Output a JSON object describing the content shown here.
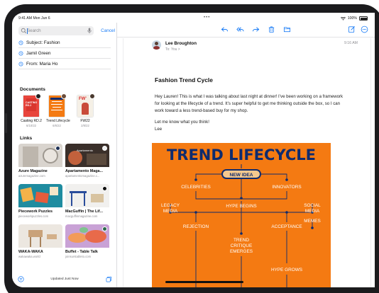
{
  "status_bar": {
    "time_date": "9:41 AM  Mon Jun 6",
    "battery": "100%"
  },
  "sidebar": {
    "search": {
      "placeholder": "Search",
      "cancel_label": "Cancel"
    },
    "suggestions": [
      {
        "label": "Subject: Fashion"
      },
      {
        "label": "Jamil Green"
      },
      {
        "label": "From: Maria Ho"
      }
    ],
    "documents_title": "Documents",
    "documents": [
      {
        "name": "Casting RD.2",
        "date": "6/10/22",
        "thumb_text": "CASTING RD.2",
        "color": "#e8453c"
      },
      {
        "name": "Trend Lifecycle",
        "date": "6/6/22",
        "thumb_text": "TREND",
        "color": "#f47a12"
      },
      {
        "name": "FW22",
        "date": "2/8/22",
        "thumb_text": "FW'22",
        "color": "#f5f0e6"
      }
    ],
    "links_title": "Links",
    "links": [
      {
        "title": "Azure Magazine",
        "url": "azuremagazine.com"
      },
      {
        "title": "Apartamento Maga...",
        "url": "apartamentomagazine.c...",
        "overlay_text": "Apartamento"
      },
      {
        "title": "Piecework Puzzles",
        "url": "pieceworkpuzzles.com"
      },
      {
        "title": "MacGuffin | The Lif...",
        "url": "macguffinmagazine.com"
      },
      {
        "title": "WAKA-WAKA",
        "url": "wakawaka.world"
      },
      {
        "title": "Buffet - Table Talk",
        "url": "joinsurstableto.com"
      }
    ],
    "updated_label": "Updated Just Now"
  },
  "message": {
    "sender": "Lee Broughton",
    "to_line": "To: You >",
    "time": "9:16 AM",
    "subject": "Fashion Trend Cycle",
    "paragraphs": [
      "Hey Lauren! This is what I was talking about last night at dinner! I’ve been working on a framework for looking at the lifecycle of a trend. It’s super helpful to get me thinking outside the box, so I can work toward a less trend-based buy for my shop.",
      "Let me know what you think!\nLee"
    ]
  },
  "infographic": {
    "title": "TREND LIFECYCLE",
    "new_idea": "NEW IDEA",
    "celebrities": "CELEBRITIES",
    "influencers": "INNOVATORS",
    "legacy_media_1": "LEGACY",
    "legacy_media_2": "MEDIA",
    "hype_begins": "HYPE BEGINS",
    "social_media_1": "SOCIAL",
    "social_media_2": "MEDIA",
    "memes": "MEMES",
    "rejection": "REJECTION",
    "trend_critique_1": "TREND",
    "trend_critique_2": "CRITIQUE",
    "trend_critique_3": "EMERGES",
    "acceptance": "ACCEPTANCE",
    "hype_grows": "HYPE GROWS"
  },
  "colors": {
    "accent": "#1a7cf6",
    "infographic_bg": "#f47a12",
    "infographic_ink": "#0e2b6e"
  }
}
